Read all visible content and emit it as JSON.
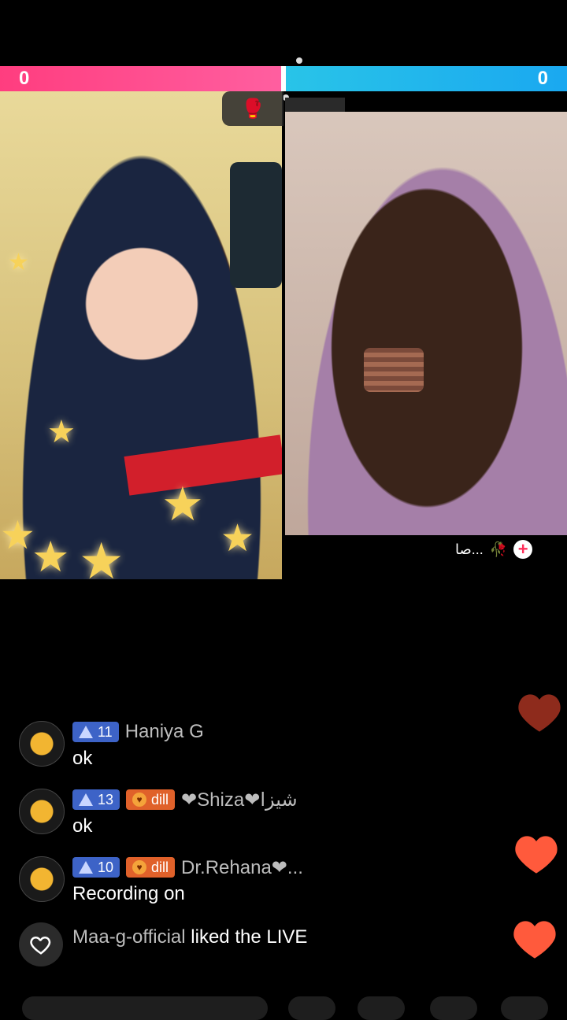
{
  "battle": {
    "left_score": "0",
    "right_score": "0",
    "left_color": "#ff4f90",
    "right_color": "#1fb2ee"
  },
  "right_host": {
    "name": "صا...",
    "emoji": "🥀"
  },
  "chat": [
    {
      "level": "11",
      "fan_badge": "",
      "username": "Haniya G",
      "message": "ok"
    },
    {
      "level": "13",
      "fan_badge": "dill",
      "username": "❤Shiza❤شیزا",
      "message": "ok"
    },
    {
      "level": "10",
      "fan_badge": "dill",
      "username": "Dr.Rehana❤...",
      "message": "Recording on"
    }
  ],
  "activity": {
    "user": "Maa-g-official",
    "action": " liked the LIVE"
  },
  "icons": [
    "versus-icon",
    "plus-icon",
    "heart-icon",
    "level-triangle-icon",
    "fan-heart-icon"
  ],
  "colors": {
    "heart_floating": "#ff5a3c",
    "heart_floating_dark": "#8e2b1c",
    "level_badge": "#3d63c7",
    "fan_badge": "#e0612a"
  }
}
